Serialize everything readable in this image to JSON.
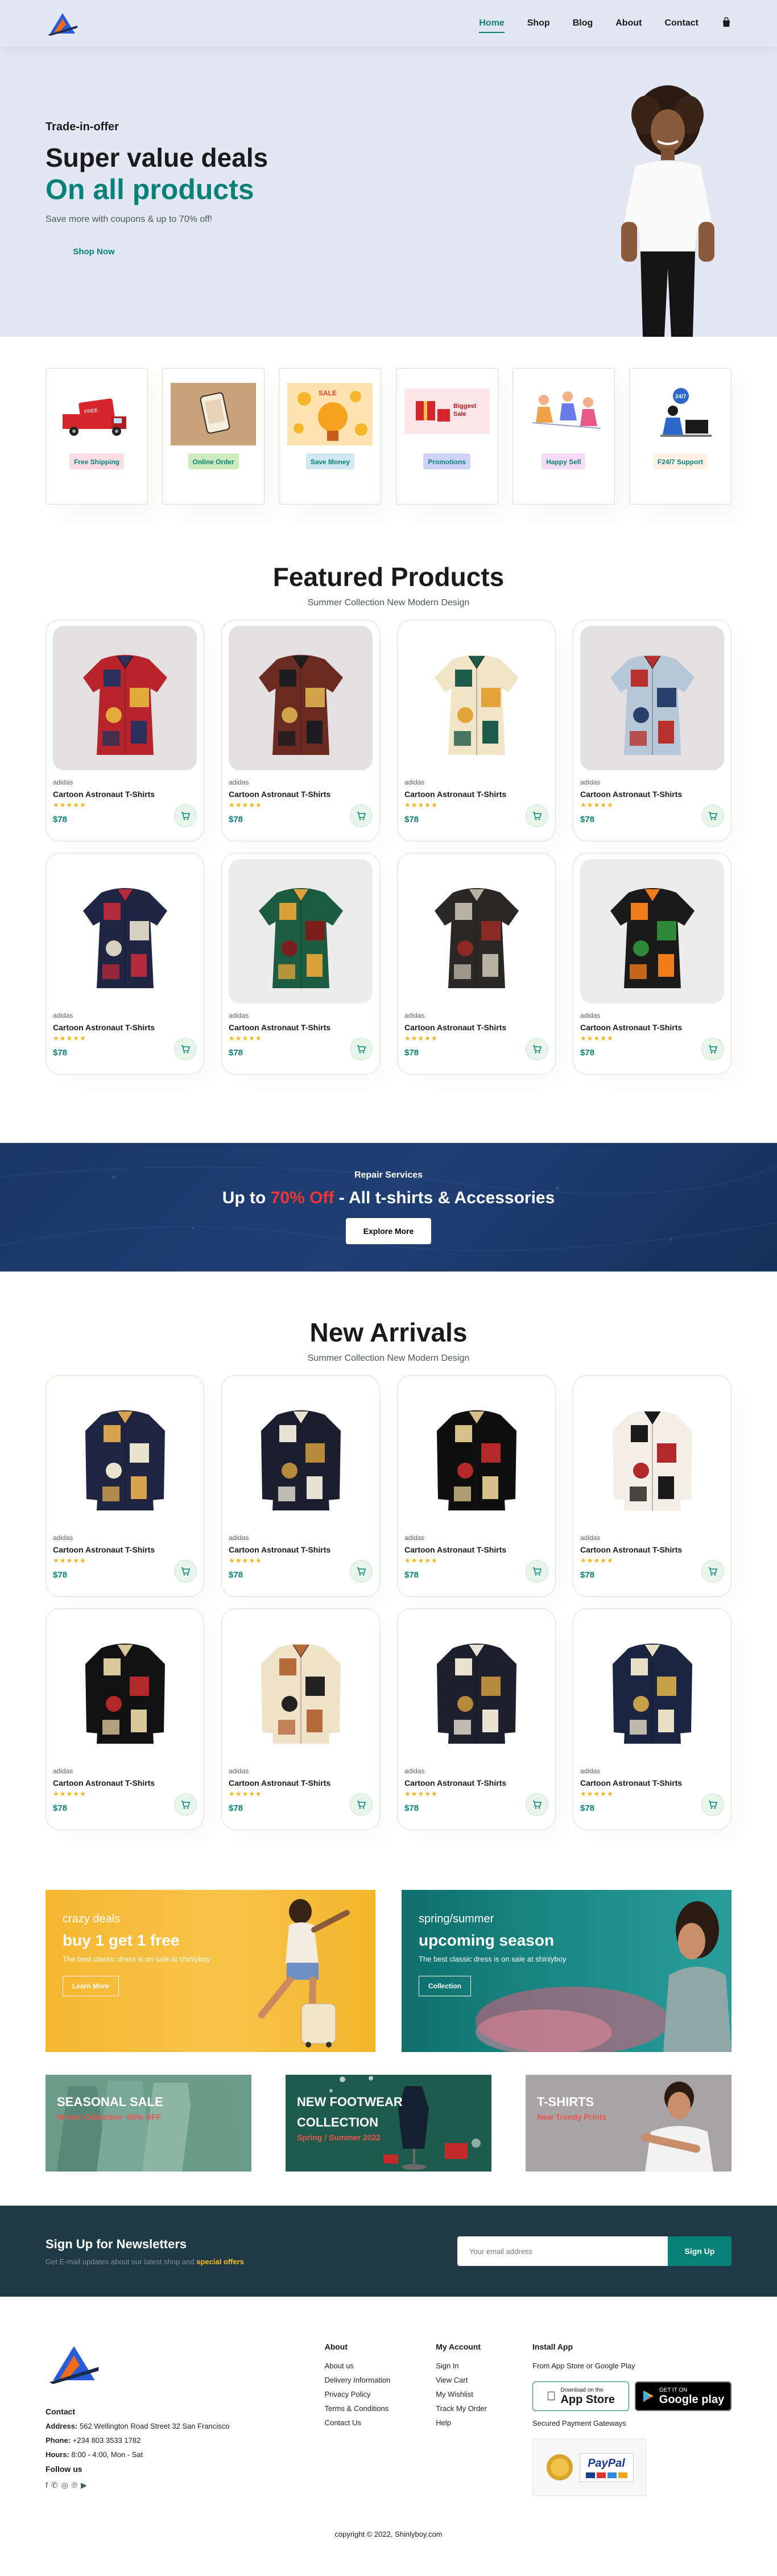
{
  "header": {
    "nav": [
      "Home",
      "Shop",
      "Blog",
      "About",
      "Contact"
    ],
    "active": "Home"
  },
  "hero": {
    "eyebrow": "Trade-in-offer",
    "title": "Super value deals",
    "highlight": "On all products",
    "subtitle": "Save more with coupons & up to 70% off!",
    "button": "Shop Now"
  },
  "features": [
    {
      "label": "Free Shipping",
      "bg": "#fddde4",
      "icon": "truck"
    },
    {
      "label": "Online Order",
      "bg": "#cdebbc",
      "icon": "phone"
    },
    {
      "label": "Save Money",
      "bg": "#d1e8f2",
      "icon": "coins"
    },
    {
      "label": "Promotions",
      "bg": "#cdd4f8",
      "icon": "gift"
    },
    {
      "label": "Happy Sell",
      "bg": "#f6dbf6",
      "icon": "people"
    },
    {
      "label": "F24/7 Support",
      "bg": "#fff2e5",
      "icon": "support"
    }
  ],
  "featured": {
    "title": "Featured Products",
    "subtitle": "Summer Collection New Modern Design",
    "products": [
      {
        "brand": "adidas",
        "name": "Cartoon Astronaut T-Shirts",
        "stars": "★★★★★",
        "price": "$78",
        "c1": "#b8242c",
        "c2": "#2b2f5a",
        "c3": "#e2a93b",
        "bg": "#e2e0e0"
      },
      {
        "brand": "adidas",
        "name": "Cartoon Astronaut T-Shirts",
        "stars": "★★★★★",
        "price": "$78",
        "c1": "#6b2b22",
        "c2": "#1d1c1e",
        "c3": "#d2a44a",
        "bg": "#e2e0e0"
      },
      {
        "brand": "adidas",
        "name": "Cartoon Astronaut T-Shirts",
        "stars": "★★★★★",
        "price": "$78",
        "c1": "#f0e5c6",
        "c2": "#1e5a4a",
        "c3": "#e2a43b",
        "bg": "#ffffff"
      },
      {
        "brand": "adidas",
        "name": "Cartoon Astronaut T-Shirts",
        "stars": "★★★★★",
        "price": "$78",
        "c1": "#b6c7d8",
        "c2": "#b7322c",
        "c3": "#2a3f6a",
        "bg": "#e2e0e0"
      },
      {
        "brand": "adidas",
        "name": "Cartoon Astronaut T-Shirts",
        "stars": "★★★★★",
        "price": "$78",
        "c1": "#1f2542",
        "c2": "#b22b3c",
        "c3": "#d6d0c0",
        "bg": "#ffffff"
      },
      {
        "brand": "adidas",
        "name": "Cartoon Astronaut T-Shirts",
        "stars": "★★★★★",
        "price": "$78",
        "c1": "#1e5c3f",
        "c2": "#d9a13a",
        "c3": "#7c1f1c",
        "bg": "#ececec"
      },
      {
        "brand": "adidas",
        "name": "Cartoon Astronaut T-Shirts",
        "stars": "★★★★★",
        "price": "$78",
        "c1": "#2a2826",
        "c2": "#b9b2a4",
        "c3": "#8a2a22",
        "bg": "#ffffff"
      },
      {
        "brand": "adidas",
        "name": "Cartoon Astronaut T-Shirts",
        "stars": "★★★★★",
        "price": "$78",
        "c1": "#1a1a1a",
        "c2": "#f07b1b",
        "c3": "#2e8a3a",
        "bg": "#ececec"
      }
    ]
  },
  "banner": {
    "eyebrow": "Repair Services",
    "title_pre": "Up to ",
    "title_hl": "70% Off",
    "title_post": " - All t-shirts & Accessories",
    "button": "Explore More"
  },
  "arrivals": {
    "title": "New Arrivals",
    "subtitle": "Summer Collection New Modern Design",
    "products": [
      {
        "brand": "adidas",
        "name": "Cartoon Astronaut T-Shirts",
        "stars": "★★★★★",
        "price": "$78",
        "c1": "#1e2540",
        "c2": "#d6a250",
        "c3": "#e9e2cd",
        "bg": "#ffffff"
      },
      {
        "brand": "adidas",
        "name": "Cartoon Astronaut T-Shirts",
        "stars": "★★★★★",
        "price": "$78",
        "c1": "#1b1e2e",
        "c2": "#e8e2d4",
        "c3": "#b58a3a",
        "bg": "#ffffff"
      },
      {
        "brand": "adidas",
        "name": "Cartoon Astronaut T-Shirts",
        "stars": "★★★★★",
        "price": "$78",
        "c1": "#0f0f0f",
        "c2": "#d8c08a",
        "c3": "#b3282a",
        "bg": "#ffffff"
      },
      {
        "brand": "adidas",
        "name": "Cartoon Astronaut T-Shirts",
        "stars": "★★★★★",
        "price": "$78",
        "c1": "#f4efe6",
        "c2": "#1a1a1a",
        "c3": "#b3282a",
        "bg": "#ffffff"
      },
      {
        "brand": "adidas",
        "name": "Cartoon Astronaut T-Shirts",
        "stars": "★★★★★",
        "price": "$78",
        "c1": "#111111",
        "c2": "#d9c79a",
        "c3": "#b3282a",
        "bg": "#ffffff"
      },
      {
        "brand": "adidas",
        "name": "Cartoon Astronaut T-Shirts",
        "stars": "★★★★★",
        "price": "$78",
        "c1": "#efe2c8",
        "c2": "#b46a3a",
        "c3": "#222222",
        "bg": "#ffffff"
      },
      {
        "brand": "adidas",
        "name": "Cartoon Astronaut T-Shirts",
        "stars": "★★★★★",
        "price": "$78",
        "c1": "#1d1f2d",
        "c2": "#e9e2d2",
        "c3": "#b58a3a",
        "bg": "#ffffff"
      },
      {
        "brand": "adidas",
        "name": "Cartoon Astronaut T-Shirts",
        "stars": "★★★★★",
        "price": "$78",
        "c1": "#1b2440",
        "c2": "#e8dfc6",
        "c3": "#c9a04a",
        "bg": "#ffffff"
      }
    ]
  },
  "sm_banners": [
    {
      "eyebrow": "crazy deals",
      "title": "buy 1 get 1 free",
      "text": "The best classic dress is on sale at shinlyboy",
      "button": "Learn More"
    },
    {
      "eyebrow": "spring/summer",
      "title": "upcoming season",
      "text": "The best classic dress is on sale at shinlyboy",
      "button": "Collection"
    }
  ],
  "banner3": [
    {
      "title": "SEASONAL SALE",
      "sub": "Winter Collection -50% OFF"
    },
    {
      "title": "NEW FOOTWEAR COLLECTION",
      "sub": "Spring / Summer 2022"
    },
    {
      "title": "T-SHIRTS",
      "sub": "New Trendy Prints"
    }
  ],
  "newsletter": {
    "title": "Sign Up for Newsletters",
    "text": "Get E-mail updates about our latest shop and ",
    "highlight": "special offers",
    "placeholder": "Your email address",
    "button": "Sign Up"
  },
  "footer": {
    "contact_title": "Contact",
    "address_label": "Address:",
    "address": "562 Wellington Road Street 32 San Francisco",
    "phone_label": "Phone:",
    "phone": "+234 803 3533 1782",
    "hours_label": "Hours:",
    "hours": "8:00 - 4:00, Mon - Sat",
    "follow": "Follow us",
    "about_title": "About",
    "about_links": [
      "About us",
      "Delivery Information",
      "Privacy Policy",
      "Terms & Conditions",
      "Contact Us"
    ],
    "account_title": "My Account",
    "account_links": [
      "Sign In",
      "View Cart",
      "My Wishlist",
      "Track My Order",
      "Help"
    ],
    "install_title": "Install App",
    "install_text": "From App Store or Google Play",
    "appstore_small": "Download on the",
    "appstore_big": "App Store",
    "google_small": "GET IT ON",
    "google_big": "Google play",
    "secured": "Secured Payment Gateways",
    "paypal": "PayPal",
    "copyright": "copyright © 2022, Shinlyboy.com"
  }
}
